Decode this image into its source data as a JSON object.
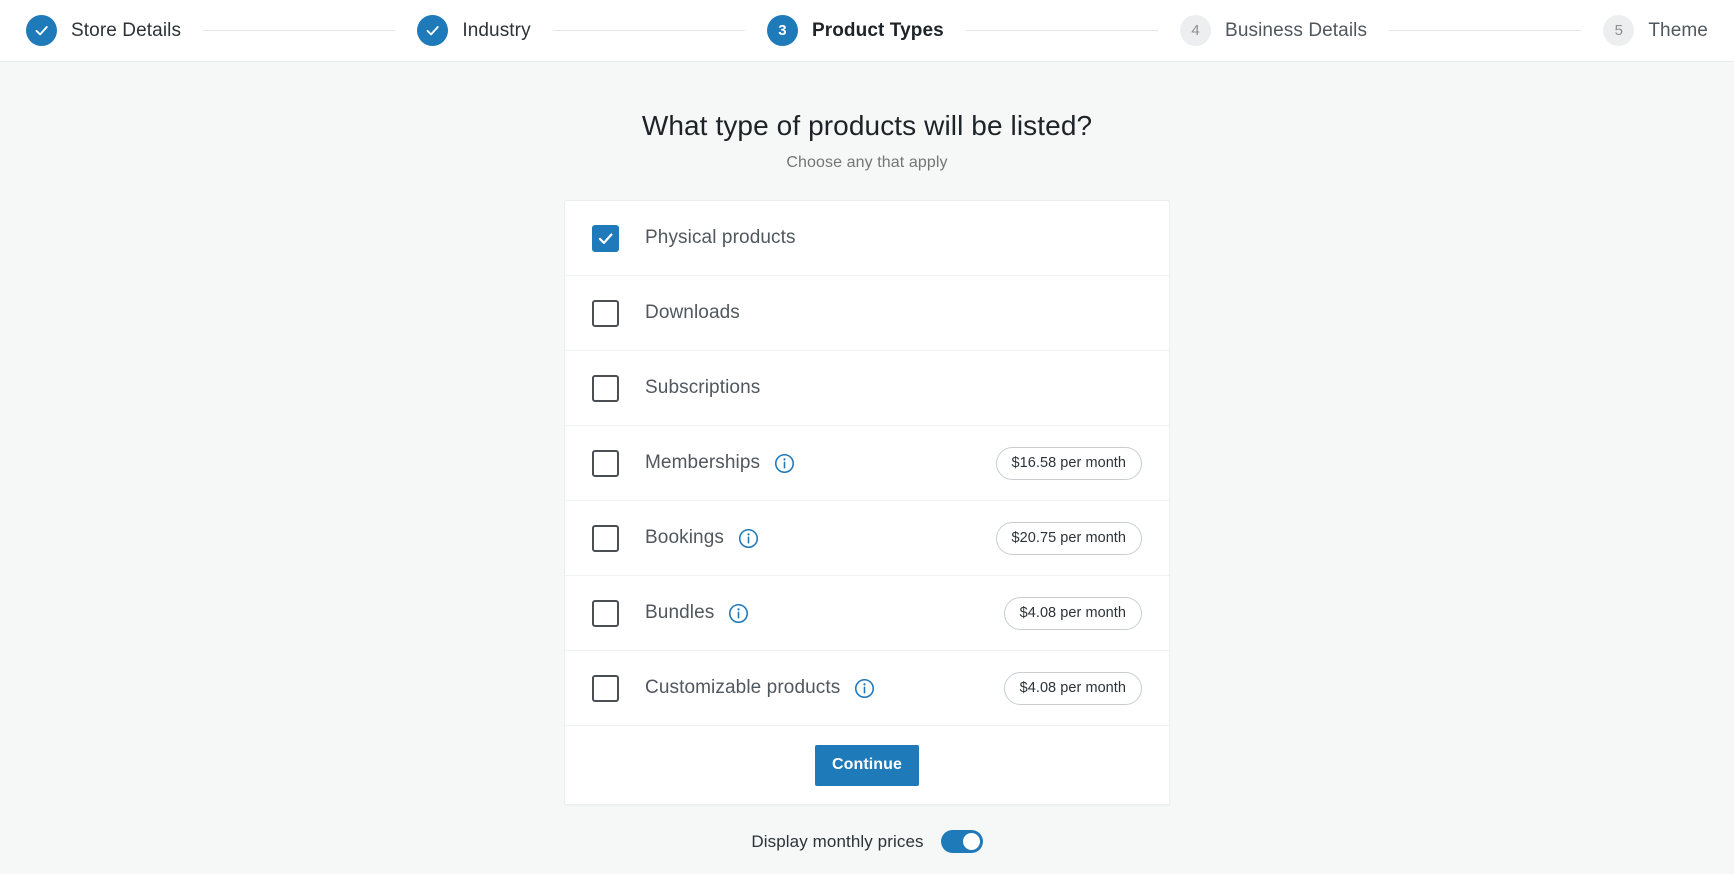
{
  "stepper": {
    "steps": [
      {
        "label": "Store Details",
        "state": "done",
        "marker": "check-icon"
      },
      {
        "label": "Industry",
        "state": "done",
        "marker": "check-icon"
      },
      {
        "label": "Product Types",
        "state": "current",
        "marker": "3"
      },
      {
        "label": "Business Details",
        "state": "pending",
        "marker": "4"
      },
      {
        "label": "Theme",
        "state": "pending",
        "marker": "5"
      }
    ]
  },
  "main": {
    "title": "What type of products will be listed?",
    "subtitle": "Choose any that apply"
  },
  "product_types": [
    {
      "label": "Physical products",
      "checked": true,
      "info": false,
      "price": ""
    },
    {
      "label": "Downloads",
      "checked": false,
      "info": false,
      "price": ""
    },
    {
      "label": "Subscriptions",
      "checked": false,
      "info": false,
      "price": ""
    },
    {
      "label": "Memberships",
      "checked": false,
      "info": true,
      "price": "$16.58 per month"
    },
    {
      "label": "Bookings",
      "checked": false,
      "info": true,
      "price": "$20.75 per month"
    },
    {
      "label": "Bundles",
      "checked": false,
      "info": true,
      "price": "$4.08 per month"
    },
    {
      "label": "Customizable products",
      "checked": false,
      "info": true,
      "price": "$4.08 per month"
    }
  ],
  "footer": {
    "continue_label": "Continue",
    "toggle_label": "Display monthly prices",
    "toggle_on": true
  },
  "colors": {
    "accent": "#1e7ab8",
    "page_bg": "#f6f7f7",
    "card_bg": "#ffffff",
    "text": "#2c3338",
    "muted_text": "#757575",
    "pending_marker_bg": "#eceeef",
    "pending_marker_text": "#8c8f94",
    "border": "#f0f1f1"
  }
}
